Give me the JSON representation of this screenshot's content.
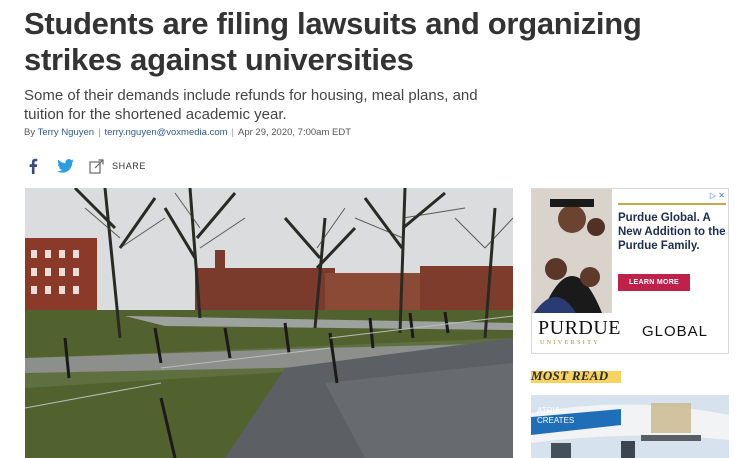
{
  "article": {
    "headline": "Students are filing lawsuits and organizing strikes against universities",
    "dek": "Some of their demands include refunds for housing, meal plans, and tuition for the shortened academic year.",
    "byline_prefix": "By ",
    "author": "Terry Nguyen",
    "email": "terry.nguyen@voxmedia.com",
    "date": "Apr 29, 2020, 7:00am EDT"
  },
  "share": {
    "label": "SHARE",
    "icons": [
      "facebook-icon",
      "twitter-icon",
      "share-icon"
    ]
  },
  "ad": {
    "headline": "Purdue Global. A New Addition to the Purdue Family.",
    "button": "LEARN MORE",
    "logo_main": "PURDUE",
    "logo_sub": "UNIVERSITY",
    "logo_right": "GLOBAL",
    "close": "▷ ✕",
    "colors": {
      "button": "#c0214a",
      "text": "#1e2d4f",
      "gold": "#c8a84c"
    }
  },
  "sidebar": {
    "most_read_label": "MOST READ",
    "plane_text": "ATRIA\nCREATES",
    "highlight_color": "#f6d35e"
  }
}
